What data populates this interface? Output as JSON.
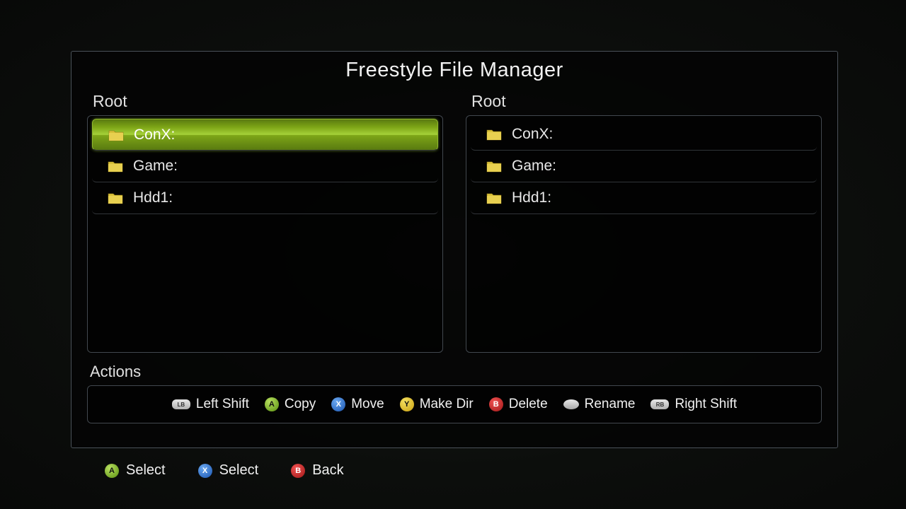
{
  "title": "Freestyle File Manager",
  "left_pane": {
    "label": "Root",
    "items": [
      {
        "name": "ConX:",
        "selected": true
      },
      {
        "name": "Game:",
        "selected": false
      },
      {
        "name": "Hdd1:",
        "selected": false
      }
    ]
  },
  "right_pane": {
    "label": "Root",
    "items": [
      {
        "name": "ConX:",
        "selected": false
      },
      {
        "name": "Game:",
        "selected": false
      },
      {
        "name": "Hdd1:",
        "selected": false
      }
    ]
  },
  "actions_label": "Actions",
  "actions": {
    "left_shift": "Left Shift",
    "copy": "Copy",
    "move": "Move",
    "make_dir": "Make Dir",
    "delete": "Delete",
    "rename": "Rename",
    "right_shift": "Right Shift"
  },
  "bottom_hints": {
    "select_a": "Select",
    "select_x": "Select",
    "back": "Back"
  },
  "button_glyphs": {
    "a": "A",
    "x": "X",
    "y": "Y",
    "b": "B",
    "lb": "LB",
    "rb": "RB"
  }
}
